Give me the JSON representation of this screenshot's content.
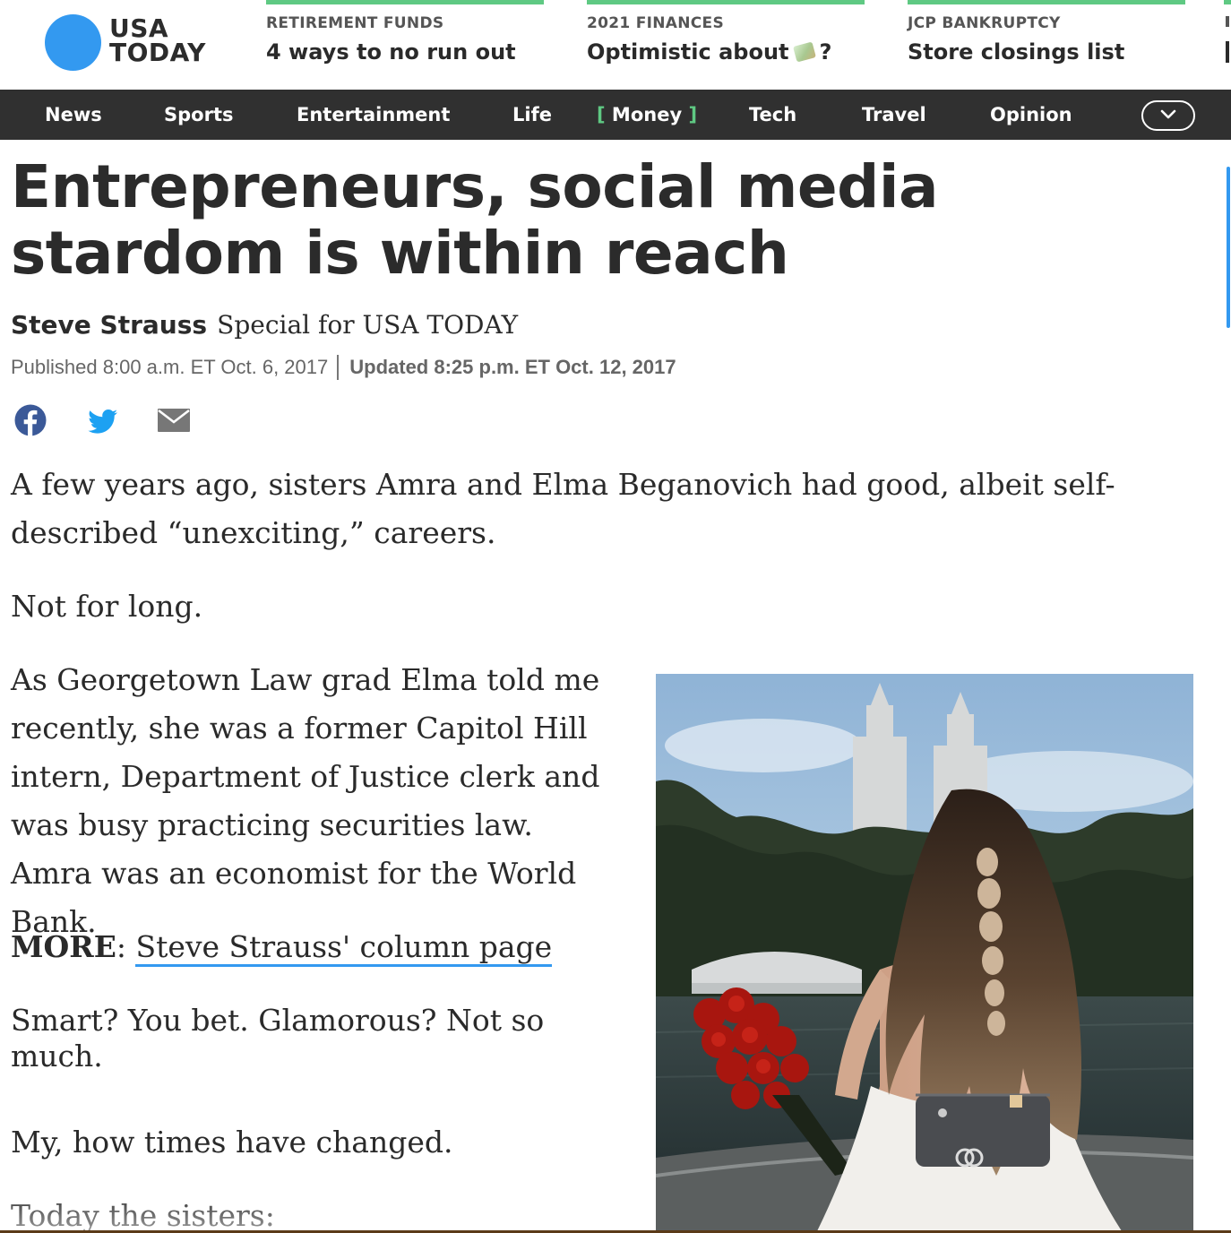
{
  "brand": {
    "line1": "USA",
    "line2": "TODAY",
    "color": "#3399f0"
  },
  "promos": [
    {
      "kicker": "RETIREMENT FUNDS",
      "headline": "4 ways to no run out"
    },
    {
      "kicker": "2021 FINANCES",
      "headline_before": "Optimistic about",
      "headline_after": "?",
      "emoji": "money-with-wings-emoji"
    },
    {
      "kicker": "JCP BANKRUPTCY",
      "headline": "Store closings list"
    }
  ],
  "nav": {
    "items": [
      "News",
      "Sports",
      "Entertainment",
      "Life",
      "Money",
      "Tech",
      "Travel",
      "Opinion"
    ],
    "active": "Money",
    "bracket_open": "[",
    "bracket_close": "]",
    "toggle_icon": "chevron-down-icon"
  },
  "article": {
    "title": "Entrepreneurs, social media stardom is within reach",
    "author": "Steve Strauss",
    "affiliation": "Special for USA TODAY",
    "published": "Published 8:00 a.m. ET Oct. 6, 2017",
    "updated": "Updated 8:25 p.m. ET Oct. 12, 2017",
    "share_icons": [
      "facebook-icon",
      "twitter-icon",
      "email-icon"
    ],
    "paragraphs": {
      "p1": "A few years ago, sisters Amra and Elma Beganovich had good, albeit self-described “unexciting,” careers.",
      "p2": "Not for long.",
      "p3": "As Georgetown Law grad Elma told me recently, she was a former Capitol Hill intern, Department of Justice clerk and was busy practicing securities law. Amra was an economist for the World Bank.",
      "p4_label": "MORE",
      "p4_colon": ": ",
      "p4_link": "Steve Strauss' column page",
      "p5_line1": "Smart? You bet. Glamorous? Not so",
      "p5_line2": "much.",
      "p6": "My, how times have changed.",
      "p7": "Today the sisters:"
    }
  },
  "colors": {
    "nav_bg": "#303030",
    "accent_green": "#5fc983",
    "link_underline": "#3399f0"
  }
}
